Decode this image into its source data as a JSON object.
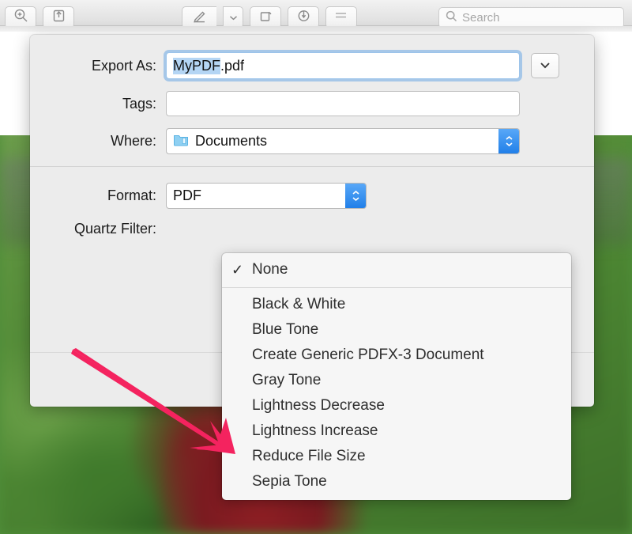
{
  "toolbar": {
    "buttons": [
      {
        "name": "zoom-in-icon",
        "label": ""
      },
      {
        "name": "share-icon",
        "label": ""
      },
      {
        "name": "markup-icon",
        "label": ""
      },
      {
        "name": "markup-dropdown-icon",
        "label": ""
      },
      {
        "name": "rotate-icon",
        "label": ""
      },
      {
        "name": "annotate-icon",
        "label": ""
      },
      {
        "name": "sidebar-icon",
        "label": ""
      }
    ],
    "search": {
      "placeholder": "Search",
      "value": ""
    }
  },
  "dialog": {
    "export_as": {
      "label": "Export As:",
      "value_selected": "MyPDF",
      "value_extension": ".pdf"
    },
    "tags": {
      "label": "Tags:",
      "value": "",
      "placeholder": ""
    },
    "where": {
      "label": "Where:",
      "value": "Documents",
      "icon": "folder-icon"
    },
    "format": {
      "label": "Format:",
      "value": "PDF"
    },
    "quartz_filter": {
      "label": "Quartz Filter:",
      "value": "None"
    }
  },
  "quartz_menu": {
    "selected": "None",
    "checkmark": "✓",
    "items": [
      {
        "label": "None",
        "checked": true
      },
      {
        "label": "Black & White",
        "checked": false
      },
      {
        "label": "Blue Tone",
        "checked": false
      },
      {
        "label": "Create Generic PDFX-3 Document",
        "checked": false
      },
      {
        "label": "Gray Tone",
        "checked": false
      },
      {
        "label": "Lightness Decrease",
        "checked": false
      },
      {
        "label": "Lightness Increase",
        "checked": false
      },
      {
        "label": "Reduce File Size",
        "checked": false
      },
      {
        "label": "Sepia Tone",
        "checked": false
      }
    ]
  },
  "annotation": {
    "arrow_color": "#f4235f",
    "points_to": "Reduce File Size"
  },
  "colors": {
    "accent_blue": "#1f7ee8",
    "selection_blue": "#b4d5f4",
    "sheet_gray": "#ececec",
    "menu_gray": "#f6f6f6"
  }
}
